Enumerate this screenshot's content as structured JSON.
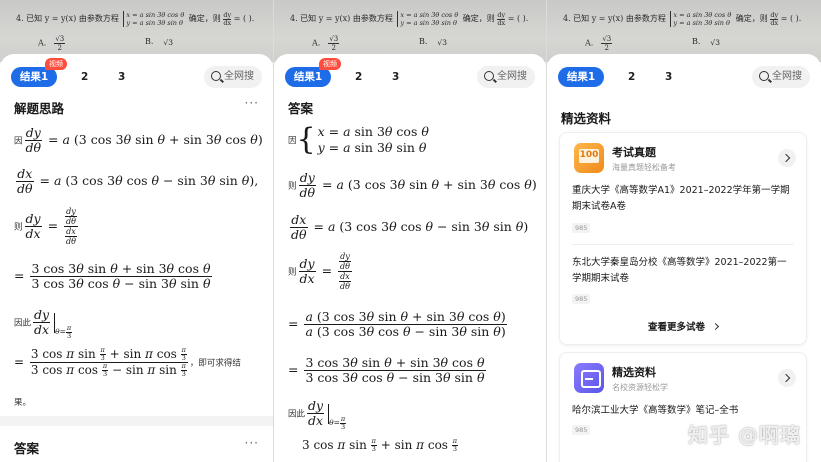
{
  "photo": {
    "question_prefix": "4. 已知 y = y(x) 由参数方程",
    "eq1": "x = a sin 3θ cos θ",
    "eq2": "y = a sin 3θ sin θ",
    "question_mid": "确定，则",
    "deriv_num": "dy",
    "deriv_den": "dx",
    "question_suffix": "= (    ).",
    "option_a": "A.",
    "option_a_num": "√3",
    "option_a_den": "2",
    "option_b": "B.",
    "option_b_val": "√3"
  },
  "tabs": {
    "active": "结果1",
    "badge": "视频",
    "t2": "2",
    "t3": "3",
    "search": "全网搜"
  },
  "panel1": {
    "title": "解题思路",
    "more": "···",
    "because": "因",
    "then": "则",
    "therefore": "因此",
    "conclusion": "，即可求得结",
    "conclusion2": "果。",
    "next_title": "答案"
  },
  "panel2": {
    "title": "答案",
    "because": "因",
    "then": "则",
    "therefore": "因此"
  },
  "panel3": {
    "title": "精选资料",
    "card1": {
      "name": "考试真题",
      "sub": "海量真题轻松备考",
      "icon_text": "100",
      "doc1": "重庆大学《高等数学A1》2021–2022学年第一学期期末试卷A卷",
      "doc1_tag": "985",
      "doc2": "东北大学秦皇岛分校《高等数学》2021–2022第一学期期末试卷",
      "doc2_tag": "985",
      "more": "查看更多试卷"
    },
    "card2": {
      "name": "精选资料",
      "sub": "名校资源轻松学",
      "doc1": "哈尔滨工业大学《高等数学》笔记–全书",
      "doc1_tag": "985"
    },
    "watermark": "知乎 @啊璃"
  }
}
